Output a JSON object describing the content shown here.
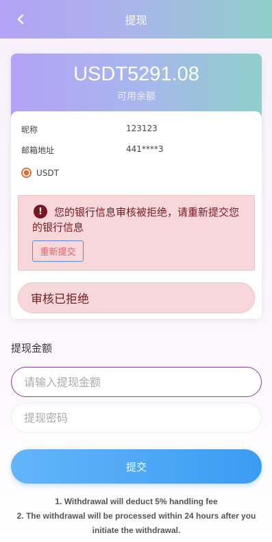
{
  "header": {
    "title": "提现",
    "back_icon": "chevron-left-icon"
  },
  "balance": {
    "amount": "USDT5291.08",
    "label": "可用余额"
  },
  "info": {
    "nickname_label": "昵称",
    "nickname_value": "123123",
    "email_label": "邮箱地址",
    "email_value": "441****3",
    "coin_label": "USDT"
  },
  "alert": {
    "icon": "!",
    "message": "您的银行信息审核被拒绝，请重新提交您的银行信息",
    "resubmit_label": "重新提交"
  },
  "status": {
    "label": "审核已拒绝"
  },
  "form": {
    "section_label": "提现金额",
    "amount_placeholder": "请输入提现金额",
    "password_placeholder": "提现密码",
    "submit_label": "提交"
  },
  "notes": [
    "1. Withdrawal will deduct 5% handling fee",
    "2. The withdrawal will be processed within 24 hours after you initiate the withdrawal."
  ],
  "colors": {
    "header_gradient_start": "#b3a2f5",
    "header_gradient_end": "#8ecfc9",
    "alert_bg": "#f8d7da",
    "alert_text": "#721c24",
    "submit_start": "#63b5f9",
    "submit_end": "#3b9cf3"
  }
}
